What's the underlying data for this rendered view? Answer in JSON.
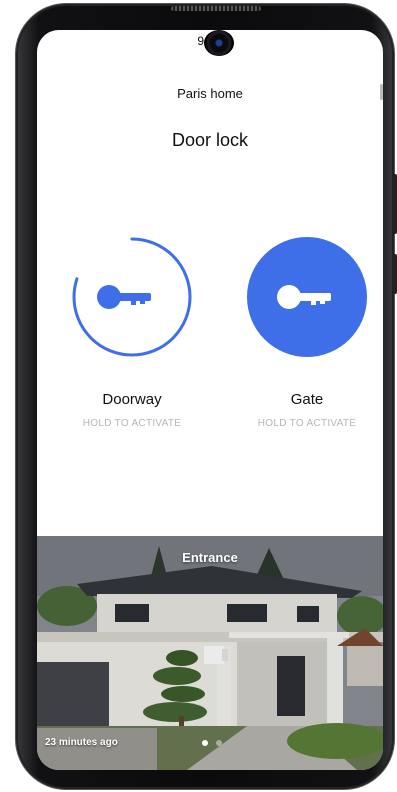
{
  "status_bar": {
    "time": "9:41"
  },
  "header": {
    "home_name": "Paris home",
    "title": "Door lock"
  },
  "locks": [
    {
      "name": "Doorway",
      "hint": "HOLD TO ACTIVATE",
      "icon": "key-icon",
      "style": "ring",
      "progress": 0.8
    },
    {
      "name": "Gate",
      "hint": "HOLD TO ACTIVATE",
      "icon": "key-icon",
      "style": "filled"
    }
  ],
  "camera_feed": {
    "title": "Entrance",
    "last_update": "23 minutes ago",
    "pages": 2,
    "active_page": 1
  },
  "colors": {
    "accent": "#3f6fe8",
    "hint_text": "#b7b7b7",
    "title_text": "#111111"
  }
}
